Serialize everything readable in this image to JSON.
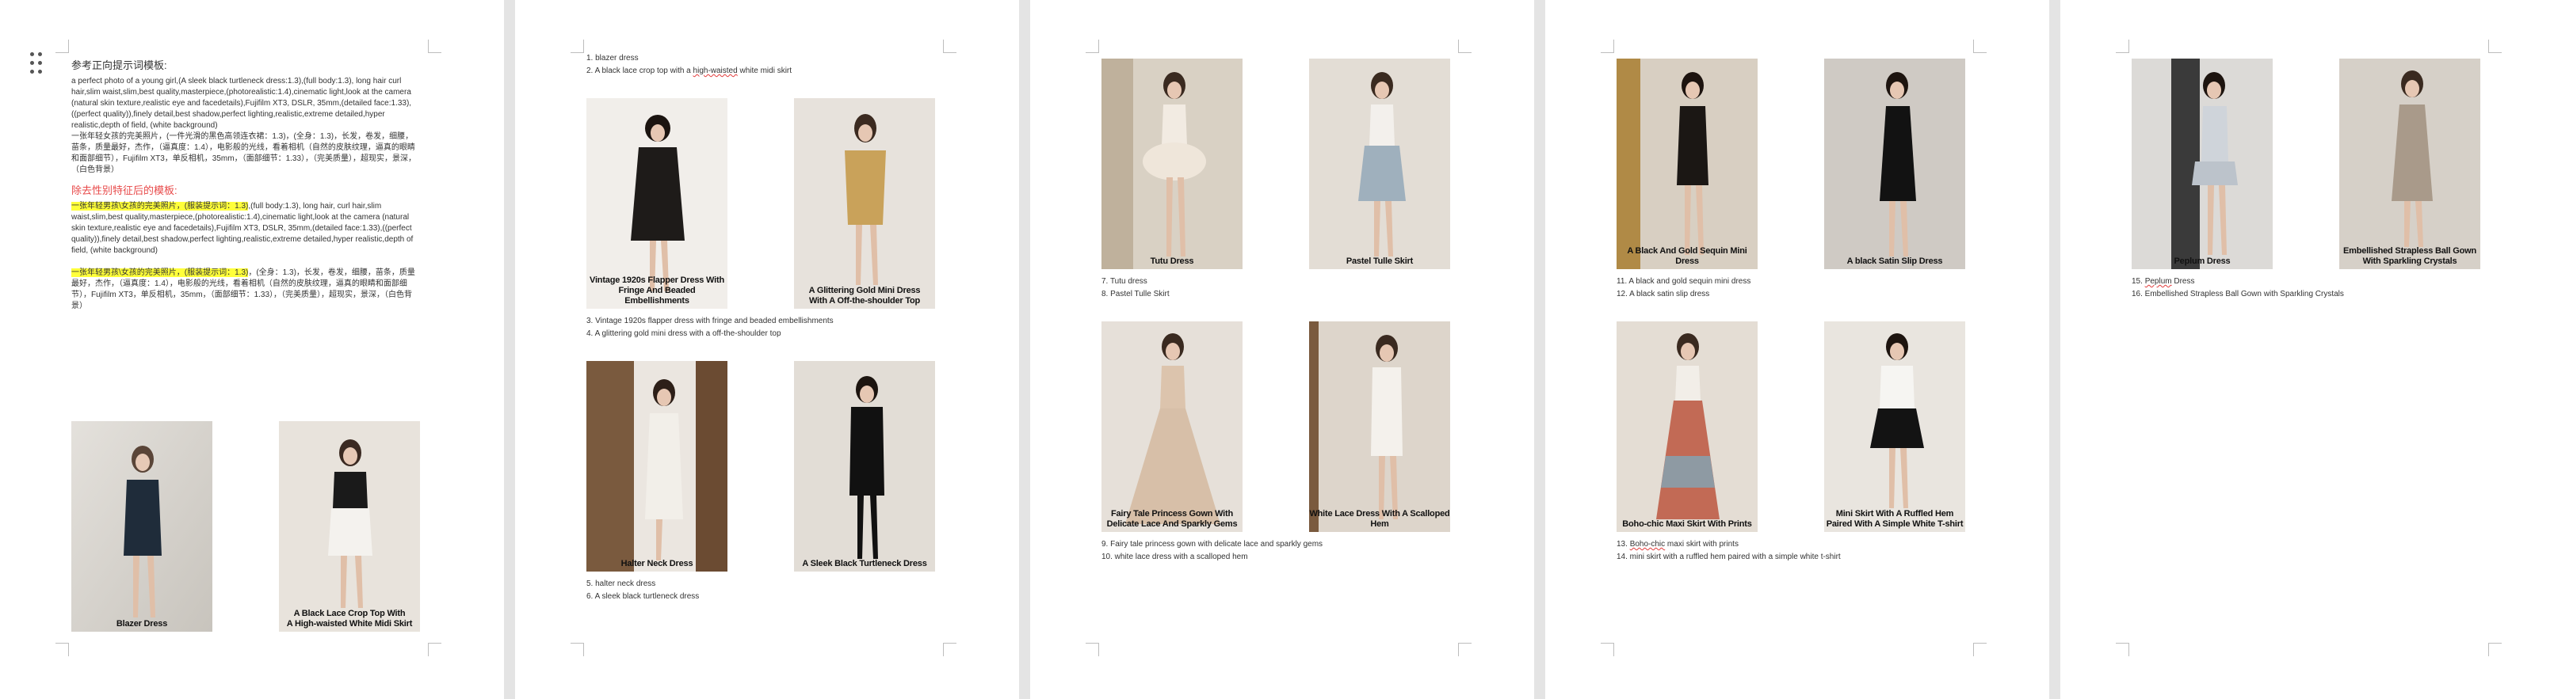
{
  "page1": {
    "section1_title": "参考正向提示词模板:",
    "section1_en": "a perfect photo of a young girl,(A sleek black turtleneck dress:1.3),(full body:1.3), long hair curl hair,slim waist,slim,best quality,masterpiece,(photorealistic:1.4),cinematic light,look at the camera (natural skin texture,realistic eye and facedetails),Fujifilm XT3, DSLR, 35mm,(detailed face:1.33),((perfect quality)),finely detail,best shadow,perfect lighting,realistic,extreme detailed,hyper realistic,depth of field, (white background)",
    "section1_cn": "一张年轻女孩的完美照片，(一件光滑的黑色高领连衣裙：1.3)，(全身：1.3)，长发，卷发，细腰，苗条，质量最好，杰作，（逼真度：1.4），电影般的光线，看着相机（自然的皮肤纹理，逼真的眼睛和面部细节），Fujifilm XT3，单反相机，35mm，（面部细节：1.33），（完美质量），超现实，景深，（白色背景）",
    "section2_title": "除去性别特征后的模板:",
    "section2_hl": "一张年轻男孩\\女孩的完美照片，(服装提示词：1.3)",
    "section2_en": ",(full body:1.3), long hair, curl hair,slim waist,slim,best quality,masterpiece,(photorealistic:1.4),cinematic light,look at the camera (natural skin texture,realistic eye and facedetails),Fujifilm XT3, DSLR, 35mm,(detailed face:1.33),((perfect quality)),finely detail,best shadow,perfect lighting,realistic,extreme detailed,hyper realistic,depth of field, (white background)",
    "section3_hl": "一张年轻男孩\\女孩的完美照片，(服装提示词：1.3)",
    "section3_cn": "，(全身：1.3)，长发，卷发，细腰，苗条，质量最好，杰作，（逼真度：1.4），电影般的光线，看着相机（自然的皮肤纹理，逼真的眼睛和面部细节），Fujifilm XT3，单反相机，35mm，（面部细节：1.33），（完美质量），超现实，景深，（白色背景）",
    "captions": [
      "Blazer Dress",
      "A Black Lace Crop Top With\nA High-waisted White Midi Skirt"
    ]
  },
  "page2": {
    "list_top": [
      "1. blazer dress",
      "2. A black lace crop top with a high-waisted white midi skirt"
    ],
    "captions_row1": [
      "Vintage 1920s Flapper Dress With\nFringe And Beaded Embellishments",
      "A Glittering Gold Mini Dress\nWith A Off-the-shoulder Top"
    ],
    "list_mid": [
      "3. Vintage 1920s flapper dress with fringe and beaded embellishments",
      "4. A glittering gold mini dress with a off-the-shoulder top"
    ],
    "captions_row2": [
      "Halter Neck Dress",
      "A Sleek Black Turtleneck Dress"
    ],
    "list_bottom": [
      "5. halter neck dress",
      "6. A sleek black turtleneck dress"
    ]
  },
  "page3": {
    "captions_row1": [
      "Tutu Dress",
      "Pastel Tulle Skirt"
    ],
    "list_mid": [
      "7. Tutu dress",
      "8. Pastel Tulle Skirt"
    ],
    "captions_row2": [
      "Fairy Tale Princess Gown With\nDelicate Lace And Sparkly Gems",
      "White Lace Dress With A Scalloped Hem"
    ],
    "list_bottom": [
      "9. Fairy tale princess gown with delicate lace and sparkly gems",
      "10. white lace dress with a scalloped hem"
    ]
  },
  "page4": {
    "captions_row1": [
      "A Black And Gold Sequin Mini Dress",
      "A black Satin Slip Dress"
    ],
    "list_mid": [
      "11. A black and gold sequin mini dress",
      "12. A black satin slip dress"
    ],
    "captions_row2": [
      "Boho-chic Maxi Skirt With Prints",
      "Mini Skirt With A Ruffled Hem\nPaired With A Simple White T-shirt"
    ],
    "list_bottom": [
      "13. Boho-chic maxi skirt with prints",
      "14. mini skirt with a ruffled hem paired with a simple white t-shirt"
    ]
  },
  "page5": {
    "captions_row1": [
      "Peplum Dress",
      "Embellished Strapless Ball Gown\nWith Sparkling Crystals"
    ],
    "list_mid": [
      "15. Peplum Dress",
      "16. Embellished Strapless Ball Gown with Sparkling Crystals"
    ]
  },
  "colors": {
    "page_bg": "#ffffff",
    "canvas_bg": "#e4e4e4",
    "highlight": "#ffff3a",
    "heading_red": "#e84a4a",
    "spell_underline": "#e23b3b"
  },
  "icons": [
    "drag-handle-icon"
  ]
}
